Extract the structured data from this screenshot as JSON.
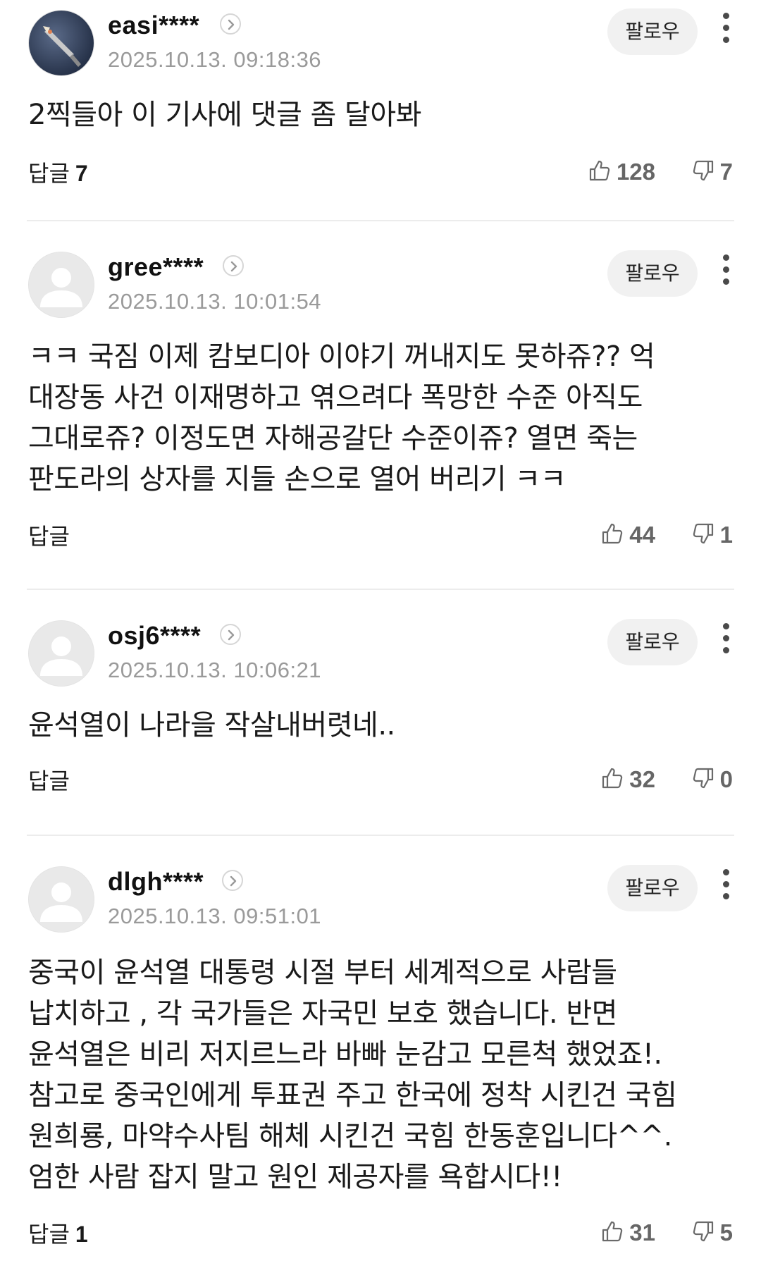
{
  "follow_label": "팔로우",
  "comments": [
    {
      "nickname": "easi****",
      "date": "2025.10.13. 09:18:36",
      "avatar": "rocket-photo",
      "text": "2찍들아 이 기사에 댓글 좀 달아봐",
      "reply_label": "답글",
      "reply_count": "7",
      "likes": "128",
      "dislikes": "7"
    },
    {
      "nickname": "gree****",
      "date": "2025.10.13. 10:01:54",
      "avatar": "default-person",
      "text": "ㅋㅋ 국짐 이제 캄보디아 이야기 꺼내지도 못하쥬?? 억 대장동 사건 이재명하고 엮으려다 폭망한 수준 아직도 그대로쥬? 이정도면 자해공갈단 수준이쥬? 열면 죽는 판도라의 상자를 지들 손으로 열어 버리기 ㅋㅋ",
      "reply_label": "답글",
      "reply_count": "",
      "likes": "44",
      "dislikes": "1"
    },
    {
      "nickname": "osj6****",
      "date": "2025.10.13. 10:06:21",
      "avatar": "default-person",
      "text": "윤석열이 나라을 작살내버렷네..",
      "reply_label": "답글",
      "reply_count": "",
      "likes": "32",
      "dislikes": "0"
    },
    {
      "nickname": "dlgh****",
      "date": "2025.10.13. 09:51:01",
      "avatar": "default-person",
      "text": "중국이 윤석열 대통령 시절 부터 세계적으로 사람들 납치하고 , 각 국가들은 자국민 보호 했습니다. 반면 윤석열은 비리 저지르느라 바빠 눈감고 모른척 했었죠!. 참고로 중국인에게 투표권 주고 한국에 정착 시킨건 국힘 원희룡, 마약수사팀 해체 시킨건 국힘 한동훈입니다^^. 엄한 사람 잡지 말고 원인 제공자를 욕합시다!!",
      "reply_label": "답글",
      "reply_count": "1",
      "likes": "31",
      "dislikes": "5"
    }
  ]
}
